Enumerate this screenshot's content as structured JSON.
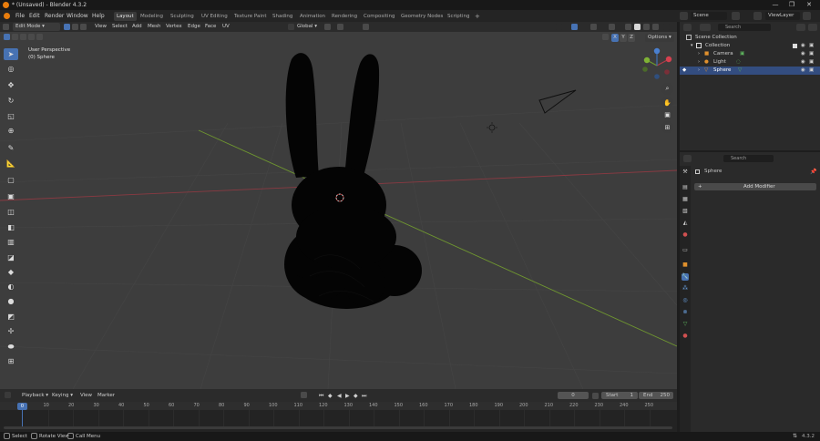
{
  "window": {
    "title": "* (Unsaved) - Blender 4.3.2",
    "minimize": "—",
    "maximize": "❐",
    "close": "✕"
  },
  "menus": [
    "File",
    "Edit",
    "Render",
    "Window",
    "Help"
  ],
  "workspaces": [
    "Layout",
    "Modeling",
    "Sculpting",
    "UV Editing",
    "Texture Paint",
    "Shading",
    "Animation",
    "Rendering",
    "Compositing",
    "Geometry Nodes",
    "Scripting"
  ],
  "workspace_add": "+",
  "scene_label": "Scene",
  "viewlayer_label": "ViewLayer",
  "viewport_header": {
    "mode": "Edit Mode",
    "menus": [
      "View",
      "Select",
      "Add",
      "Mesh",
      "Vertex",
      "Edge",
      "Face",
      "UV"
    ],
    "orientation": "Global",
    "axes": [
      "X",
      "Y",
      "Z"
    ],
    "options": "Options"
  },
  "overlay_text": {
    "perspective": "User Perspective",
    "object": "(0) Sphere"
  },
  "timeline": {
    "menus": [
      "Playback",
      "Keying",
      "View",
      "Marker"
    ],
    "current_frame": "0",
    "start_label": "Start",
    "start": "1",
    "end_label": "End",
    "end": "250",
    "ticks": [
      "0",
      "10",
      "20",
      "30",
      "40",
      "50",
      "60",
      "70",
      "80",
      "90",
      "100",
      "110",
      "120",
      "130",
      "140",
      "150",
      "160",
      "170",
      "180",
      "190",
      "200",
      "210",
      "220",
      "230",
      "240",
      "250"
    ],
    "playhead": "0"
  },
  "statusbar": {
    "select": "Select",
    "rotate": "Rotate View",
    "call_menu": "Call Menu",
    "version": "4.3.2"
  },
  "outliner": {
    "search_placeholder": "Search",
    "rows": [
      {
        "label": "Scene Collection"
      },
      {
        "label": "Collection"
      },
      {
        "label": "Camera"
      },
      {
        "label": "Light"
      },
      {
        "label": "Sphere"
      }
    ]
  },
  "properties": {
    "search_placeholder": "Search",
    "object_name": "Sphere",
    "add_modifier": "Add Modifier"
  },
  "colors": {
    "accent": "#4772b3",
    "viewport_bg": "#3d3d3d",
    "x_axis": "#a03a46",
    "y_axis": "#7aa23a"
  }
}
